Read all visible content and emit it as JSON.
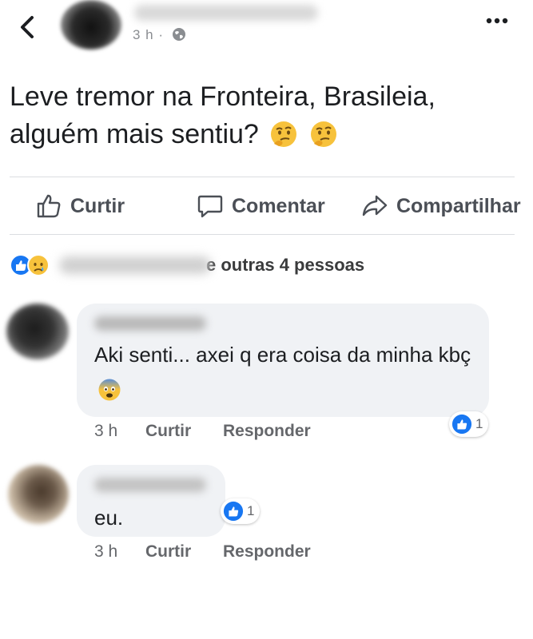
{
  "header": {
    "time": "3 h",
    "separator": "·"
  },
  "post": {
    "text": "Leve tremor na Fronteira, Brasileia, alguém mais sentiu?",
    "emojis": [
      "thinking-face",
      "thinking-face"
    ]
  },
  "actions": {
    "like": "Curtir",
    "comment": "Comentar",
    "share": "Compartilhar"
  },
  "reactions": {
    "types": [
      "like",
      "sad"
    ],
    "text": "e outras 4 pessoas"
  },
  "comments": [
    {
      "text": "Aki senti... axei q era coisa da minha kbç",
      "emoji": "fearful-face",
      "time": "3 h",
      "like_label": "Curtir",
      "reply_label": "Responder",
      "likes": "1"
    },
    {
      "text": "eu.",
      "time": "3 h",
      "like_label": "Curtir",
      "reply_label": "Responder",
      "likes": "1"
    }
  ],
  "colors": {
    "like_blue": "#1877f2",
    "bubble": "#f0f2f5",
    "meta_gray": "#65676b"
  }
}
